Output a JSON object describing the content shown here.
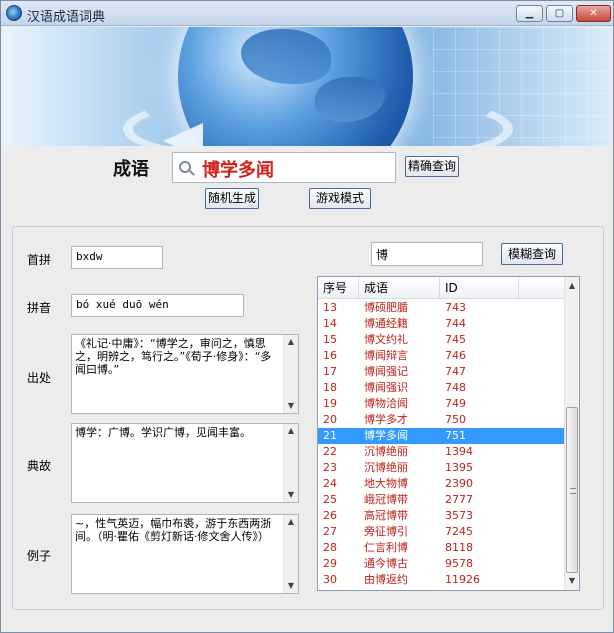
{
  "window": {
    "title": "汉语成语词典",
    "minimize": "▁",
    "maximize": "▢",
    "close": "✕"
  },
  "search": {
    "label": "成语",
    "value": "博学多闻",
    "exact_button": "精确查询",
    "random_button": "随机生成",
    "game_button": "游戏模式"
  },
  "fields": {
    "shoupin_label": "首拼",
    "shoupin_value": "bxdw",
    "pinyin_label": "拼音",
    "pinyin_value": "bó  xué  duō  wén",
    "chuchu_label": "出处",
    "chuchu_value": "《礼记·中庸》：“博学之，审问之，慎思之，明辨之，笃行之。”《荀子·修身》：“多闻曰博。”",
    "diangu_label": "典故",
    "diangu_value": "博学：广博。学识广博，见闻丰富。",
    "lizi_label": "例子",
    "lizi_value": "~，性气英迈，幅巾布裘，游于东西两浙间。（明·瞿佑《剪灯新话·修文舍人传》）"
  },
  "fuzzy": {
    "input_value": "博",
    "button": "模糊查询"
  },
  "list": {
    "headers": [
      "序号",
      "成语",
      "ID"
    ],
    "rows": [
      {
        "no": "13",
        "idiom": "博硕肥腯",
        "id": "743"
      },
      {
        "no": "14",
        "idiom": "博通经籍",
        "id": "744"
      },
      {
        "no": "15",
        "idiom": "博文约礼",
        "id": "745"
      },
      {
        "no": "16",
        "idiom": "博闻辩言",
        "id": "746"
      },
      {
        "no": "17",
        "idiom": "博闻强记",
        "id": "747"
      },
      {
        "no": "18",
        "idiom": "博闻强识",
        "id": "748"
      },
      {
        "no": "19",
        "idiom": "博物洽闻",
        "id": "749"
      },
      {
        "no": "20",
        "idiom": "博学多才",
        "id": "750"
      },
      {
        "no": "21",
        "idiom": "博学多闻",
        "id": "751"
      },
      {
        "no": "22",
        "idiom": "沉博绝丽",
        "id": "1394"
      },
      {
        "no": "23",
        "idiom": "沉博绝丽",
        "id": "1395"
      },
      {
        "no": "24",
        "idiom": "地大物博",
        "id": "2390"
      },
      {
        "no": "25",
        "idiom": "峨冠博带",
        "id": "2777"
      },
      {
        "no": "26",
        "idiom": "高冠博带",
        "id": "3573"
      },
      {
        "no": "27",
        "idiom": "旁征博引",
        "id": "7245"
      },
      {
        "no": "28",
        "idiom": "仁言利博",
        "id": "8118"
      },
      {
        "no": "29",
        "idiom": "通今博古",
        "id": "9578"
      },
      {
        "no": "30",
        "idiom": "由博返约",
        "id": "11926"
      }
    ],
    "selected_index": 8
  },
  "colors": {
    "accent_red": "#d0211b",
    "selection": "#3399ff"
  }
}
